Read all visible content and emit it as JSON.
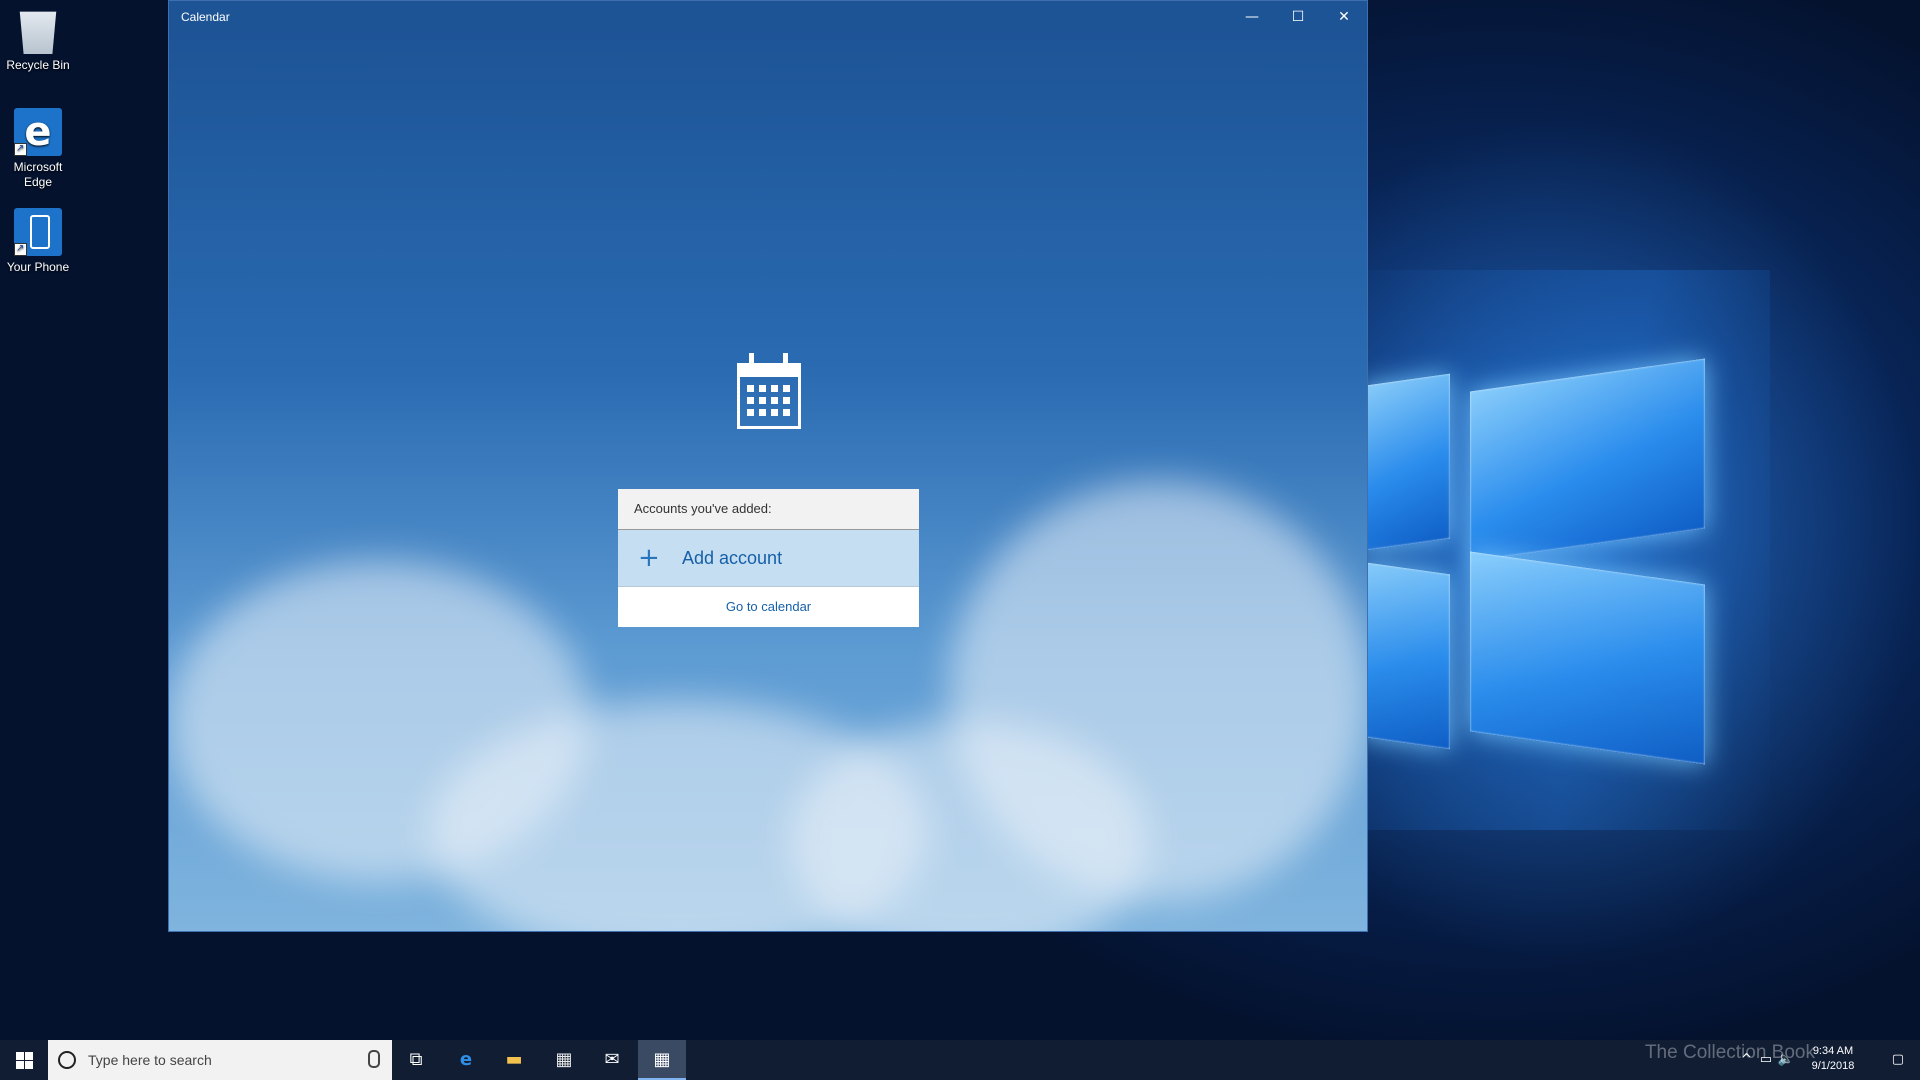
{
  "desktop": {
    "icons": [
      {
        "label": "Recycle Bin",
        "icon": "recycle-bin-icon"
      },
      {
        "label": "Microsoft Edge",
        "icon": "edge-icon"
      },
      {
        "label": "Your Phone",
        "icon": "phone-icon"
      }
    ]
  },
  "window": {
    "title": "Calendar",
    "controls": {
      "minimize": "—",
      "maximize": "☐",
      "close": "✕"
    },
    "app_icon": "calendar-icon",
    "accounts_panel": {
      "header": "Accounts you've added:",
      "add_account": "Add account",
      "add_icon": "plus-icon",
      "go_to_calendar": "Go to calendar"
    }
  },
  "taskbar": {
    "search_placeholder": "Type here to search",
    "apps": [
      "task-view-icon",
      "edge-icon",
      "file-explorer-icon",
      "store-icon",
      "mail-icon",
      "calendar-icon"
    ],
    "active_app": "calendar-icon",
    "clock": {
      "time": "9:34 AM",
      "date": "9/1/2018"
    },
    "watermark": "The Collection Book"
  },
  "colors": {
    "accent": "#1660a8",
    "titlebar": "#1d5496",
    "taskbar": "#101d33"
  }
}
